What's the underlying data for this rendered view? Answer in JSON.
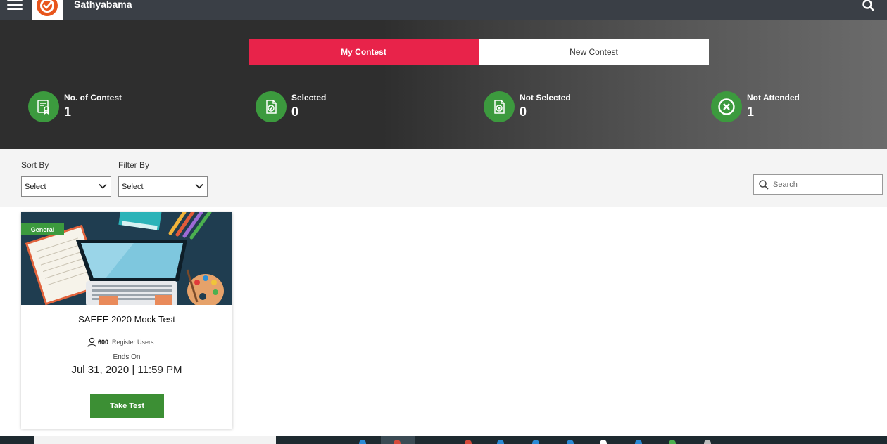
{
  "header": {
    "brand": "Sathyabama",
    "menu_icon": "hamburger-menu-icon",
    "logo_icon": "check-circle-logo-icon",
    "search_icon": "search-icon"
  },
  "tabs": [
    {
      "label": "My Contest",
      "active": true
    },
    {
      "label": "New Contest",
      "active": false
    }
  ],
  "stats": [
    {
      "label": "No. of Contest",
      "value": "1",
      "icon": "certificate-icon"
    },
    {
      "label": "Selected",
      "value": "0",
      "icon": "document-check-icon"
    },
    {
      "label": "Not Selected",
      "value": "0",
      "icon": "document-cross-icon"
    },
    {
      "label": "Not Attended",
      "value": "1",
      "icon": "cross-circle-icon"
    }
  ],
  "filters": {
    "sort_label": "Sort By",
    "sort_value": "Select",
    "filter_label": "Filter By",
    "filter_value": "Select",
    "search_placeholder": "Search"
  },
  "contests": [
    {
      "badge": "General",
      "title": "SAEEE 2020 Mock Test",
      "users_count": "600",
      "users_label": "Register Users",
      "ends_label": "Ends On",
      "ends_date": "Jul 31, 2020 | 11:59 PM",
      "button": "Take Test",
      "image": "laptop-stationery-illustration"
    }
  ],
  "colors": {
    "accent": "#e8234a",
    "success": "#3c9a3e",
    "navbar": "#3a3f46"
  }
}
